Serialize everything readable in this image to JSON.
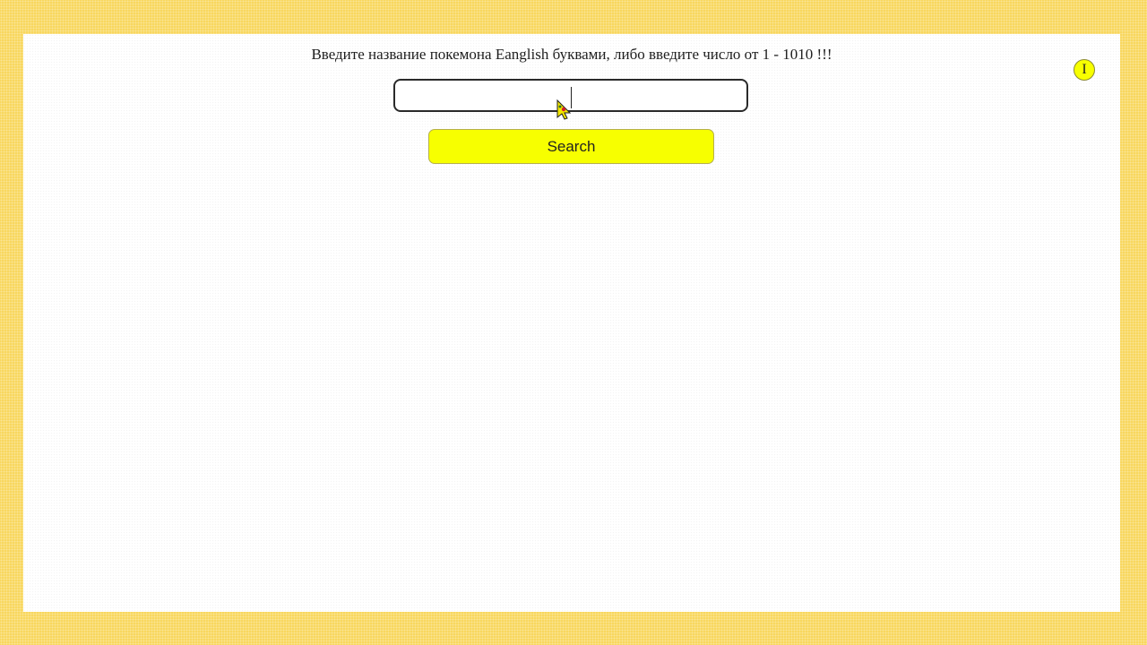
{
  "page": {
    "prompt_text": "Введите название покемона Eanglish буквами, либо введите число от 1 - 1010 !!!"
  },
  "search": {
    "value": "",
    "placeholder": "",
    "button_label": "Search"
  },
  "info_button": {
    "label": "I"
  },
  "colors": {
    "page_background": "#f8d75e",
    "panel_background": "#ffffff",
    "button_accent": "#f7ff00"
  },
  "icons": {
    "cursor": "pokeball-hand-cursor-icon"
  }
}
